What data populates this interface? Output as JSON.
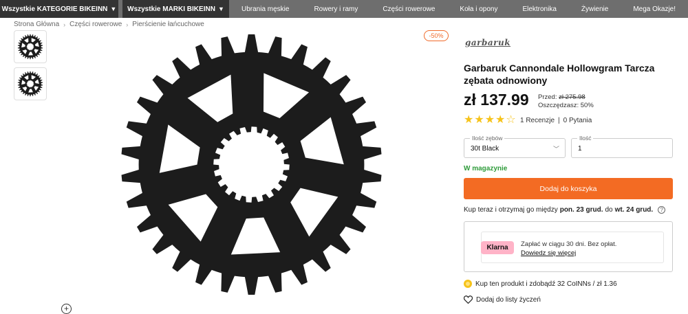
{
  "nav": {
    "categories_label": "Wszystkie KATEGORIE BIKEINN",
    "brands_label": "Wszystkie MARKI BIKEINN",
    "items": [
      "Ubrania męskie",
      "Rowery i ramy",
      "Części rowerowe",
      "Koła i opony",
      "Elektronika",
      "Żywienie",
      "Mega Okazje!"
    ]
  },
  "breadcrumb": [
    "Strona Główna",
    "Części rowerowe",
    "Pierścienie łańcuchowe"
  ],
  "product": {
    "discount_badge": "-50%",
    "brand": "garbaruk",
    "title": "Garbaruk Cannondale Hollowgram Tarcza zębata odnowiony",
    "price": "zł 137.99",
    "old_price_label": "Przed:",
    "old_price": "zł 275.98",
    "savings": "Oszczędzasz: 50%",
    "rating": 4,
    "rating_max": 5,
    "reviews": "1 Recenzje",
    "reviews_sep": "|",
    "questions": "0 Pytania",
    "teeth_label": "Ilość zębów",
    "teeth_value": "30t Black",
    "qty_label": "Ilość",
    "qty_value": "1",
    "stock": "W magazynie",
    "add_to_cart": "Dodaj do koszyka",
    "delivery_pre": "Kup teraz i otrzymaj go między",
    "delivery_from": "pon. 23 grud.",
    "delivery_mid": "do",
    "delivery_to": "wt. 24 grud.",
    "klarna_logo": "Klarna",
    "klarna_text": "Zapłać w ciągu 30 dni. Bez opłat.",
    "klarna_link": "Dowiedz się więcej",
    "coins_text": "Kup ten produkt i zdobądź 32 CoINNs / zł 1.36",
    "wishlist": "Dodaj do listy życzeń"
  },
  "icons": {
    "caret": "caret-down-icon",
    "zoom": "zoom-plus-icon",
    "heart": "heart-icon",
    "help": "question-icon",
    "coin": "coin-icon"
  },
  "colors": {
    "accent": "#f36b23",
    "nav_bg": "#6e6e6e",
    "nav_dark": "#333333",
    "stock_green": "#2e9b3a",
    "star": "#f6c31a",
    "klarna_pink": "#ffb3c7"
  }
}
